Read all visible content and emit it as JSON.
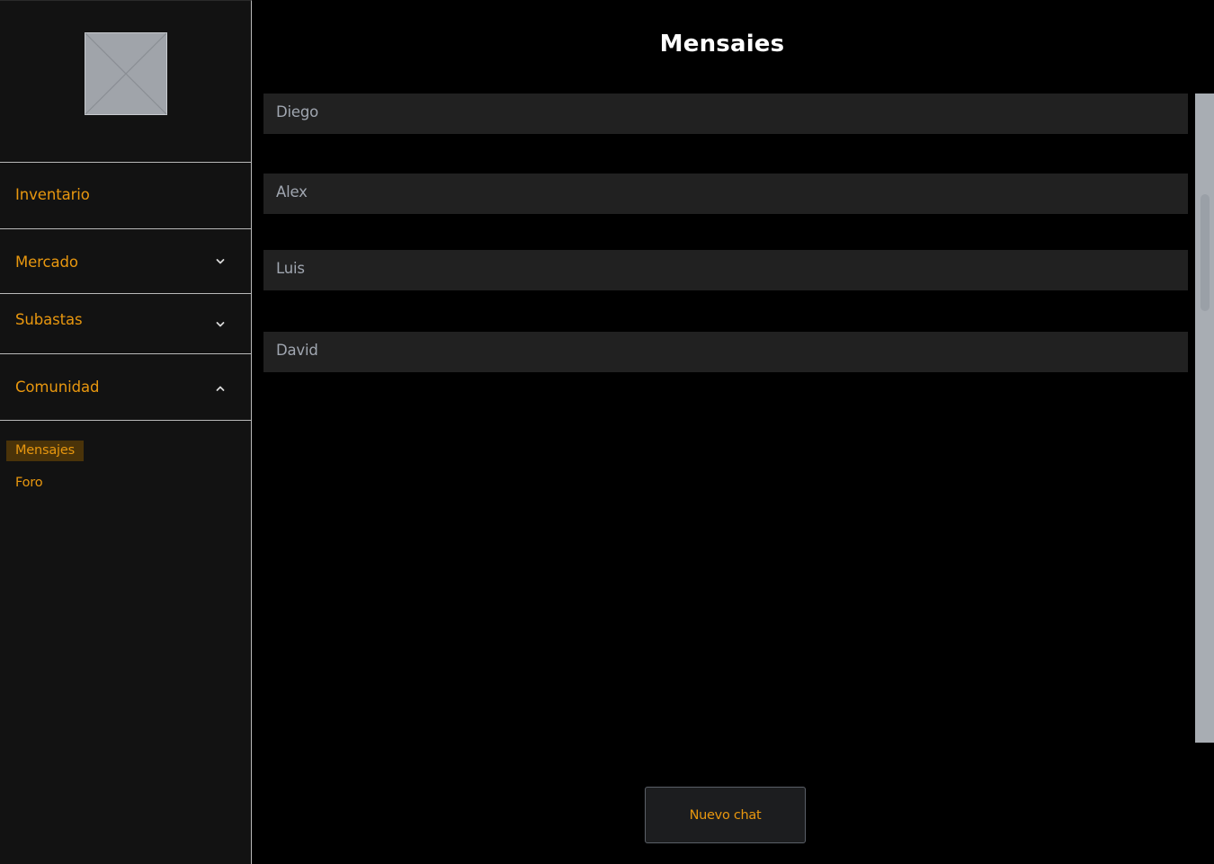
{
  "sidebar": {
    "logo_icon": "image-placeholder-icon",
    "items": [
      {
        "label": "Inventario",
        "icon": ""
      },
      {
        "label": "Mercado",
        "icon": "chevron-down-icon"
      },
      {
        "label": "Subastas",
        "icon": "chevron-down-icon"
      },
      {
        "label": "Comunidad",
        "icon": "chevron-up-icon"
      }
    ],
    "subitems": [
      {
        "label": "Mensajes",
        "active": true
      },
      {
        "label": "Foro",
        "active": false
      }
    ]
  },
  "main": {
    "title": "Mensaies",
    "chats": [
      {
        "name": "Diego"
      },
      {
        "name": "Alex"
      },
      {
        "name": "Luis"
      },
      {
        "name": "David"
      }
    ],
    "new_chat_label": "Nuevo chat"
  },
  "colors": {
    "accent": "#e8970f",
    "sidebar_bg": "#121212",
    "row_bg": "#212121",
    "active_sub_bg": "#4a3309",
    "page_bg": "#000000"
  }
}
